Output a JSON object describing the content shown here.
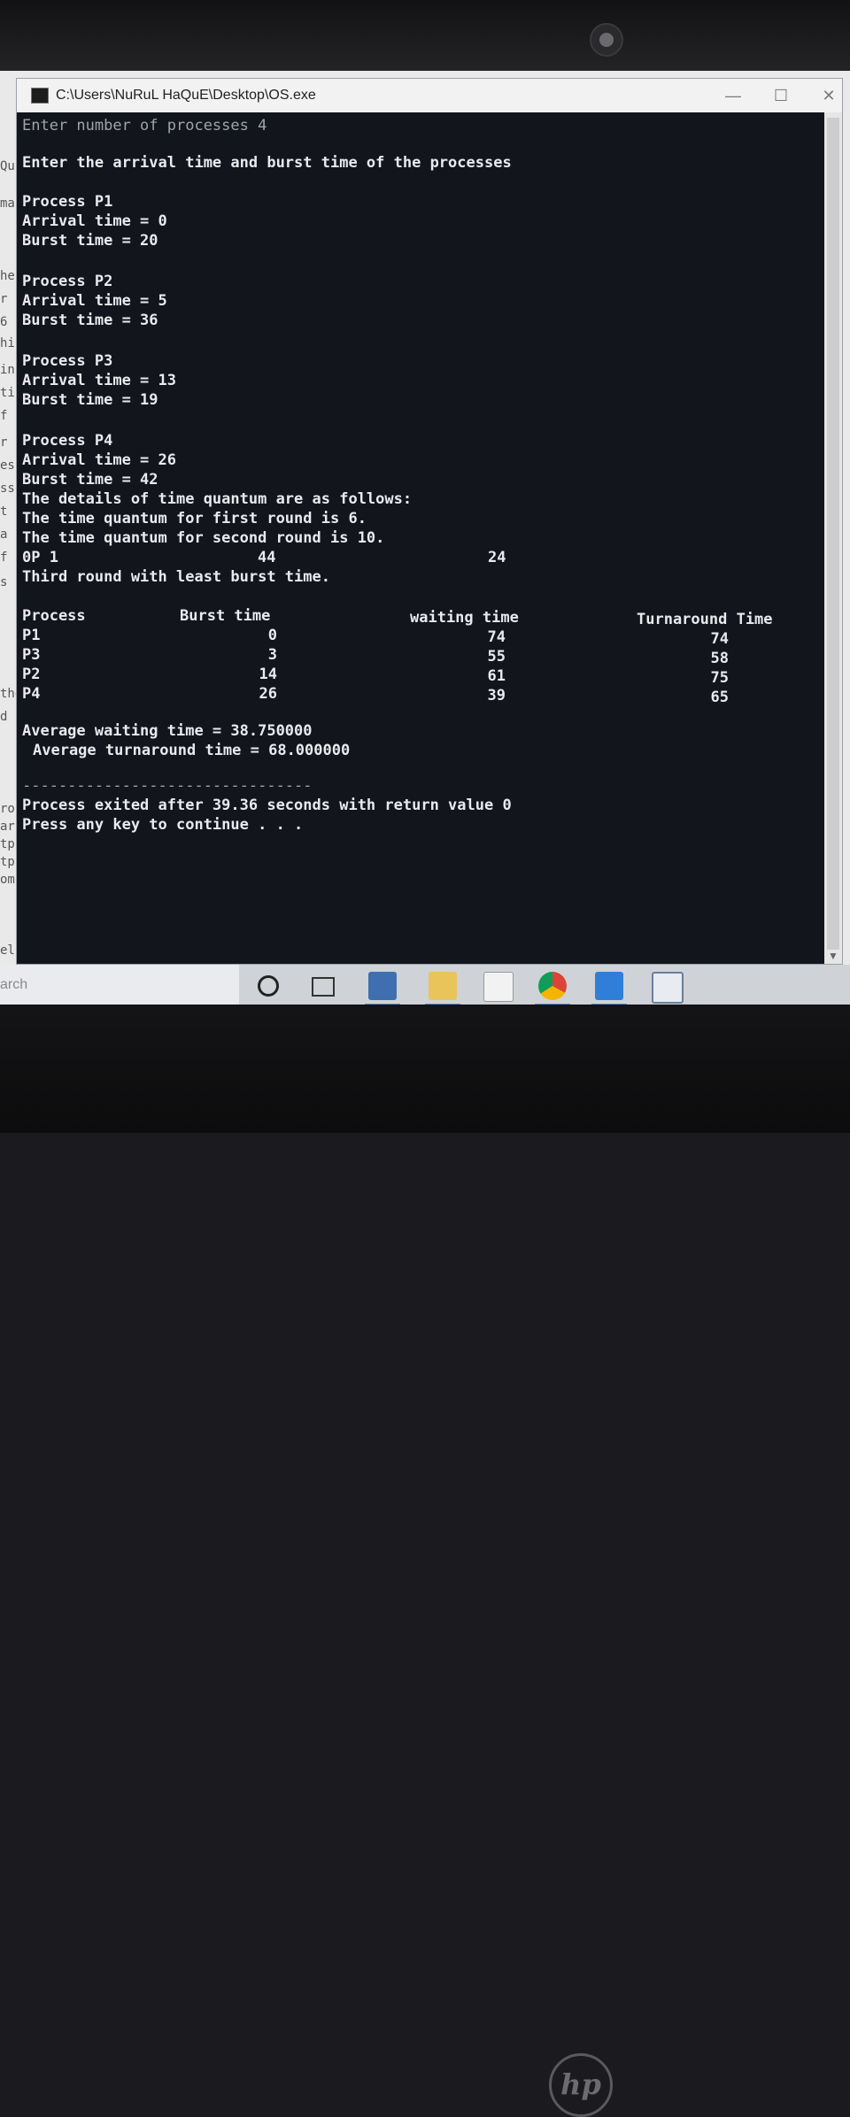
{
  "window": {
    "title": "C:\\Users\\NuRuL HaQuE\\Desktop\\OS.exe",
    "minimize_glyph": "—",
    "maximize_glyph": "☐",
    "close_glyph": "✕"
  },
  "console": {
    "prompt_count": "Enter number of processes 4",
    "prompt_times": "Enter the arrival time and burst time of the processes",
    "processes": [
      {
        "header": "Process P1",
        "arrival": "Arrival time = 0",
        "burst": "Burst time = 20"
      },
      {
        "header": "Process P2",
        "arrival": "Arrival time = 5",
        "burst": "Burst time = 36"
      },
      {
        "header": "Process P3",
        "arrival": "Arrival time = 13",
        "burst": "Burst time = 19"
      },
      {
        "header": "Process P4",
        "arrival": "Arrival time = 26",
        "burst": "Burst time = 42"
      }
    ],
    "quantum_details": "The details of time quantum are as follows:",
    "quantum_first": "The time quantum for first round is 6.",
    "quantum_second": "The time quantum for second round is 10.",
    "op_line": {
      "label": "0P 1",
      "value_a": "44",
      "value_b": "24"
    },
    "third_round": "Third round with least burst time.",
    "table": {
      "headers": [
        "Process",
        "Burst time",
        "waiting time",
        "Turnaround Time"
      ],
      "rows": [
        {
          "process": "P1",
          "burst": "0",
          "waiting": "74",
          "turnaround": "74"
        },
        {
          "process": "P3",
          "burst": "3",
          "waiting": "55",
          "turnaround": "58"
        },
        {
          "process": "P2",
          "burst": "14",
          "waiting": "61",
          "turnaround": "75"
        },
        {
          "process": "P4",
          "burst": "26",
          "waiting": "39",
          "turnaround": "65"
        }
      ]
    },
    "avg_waiting": "Average waiting time = 38.750000",
    "avg_turnaround": "Average turnaround time = 68.000000",
    "separator": "--------------------------------",
    "exit_message": "Process exited after 39.36 seconds with return value 0",
    "continue_prompt": "Press any key to continue . . ."
  },
  "background_fragments": [
    "Qu",
    "ma",
    "he",
    "r",
    "6",
    "hi",
    "in",
    "ti",
    "f",
    "r",
    "es",
    "ss",
    "t",
    "a",
    "f",
    "s",
    "the",
    "d",
    "ro",
    "arn",
    "tp",
    "tp",
    "omp",
    "el:"
  ],
  "taskbar": {
    "search_text": "arch",
    "icons": [
      "cortana-icon",
      "task-view-icon",
      "app-icon",
      "file-explorer-icon",
      "store-icon",
      "chrome-icon",
      "dev-app-icon",
      "window-app-icon"
    ]
  },
  "hardware": {
    "logo": "hp"
  }
}
